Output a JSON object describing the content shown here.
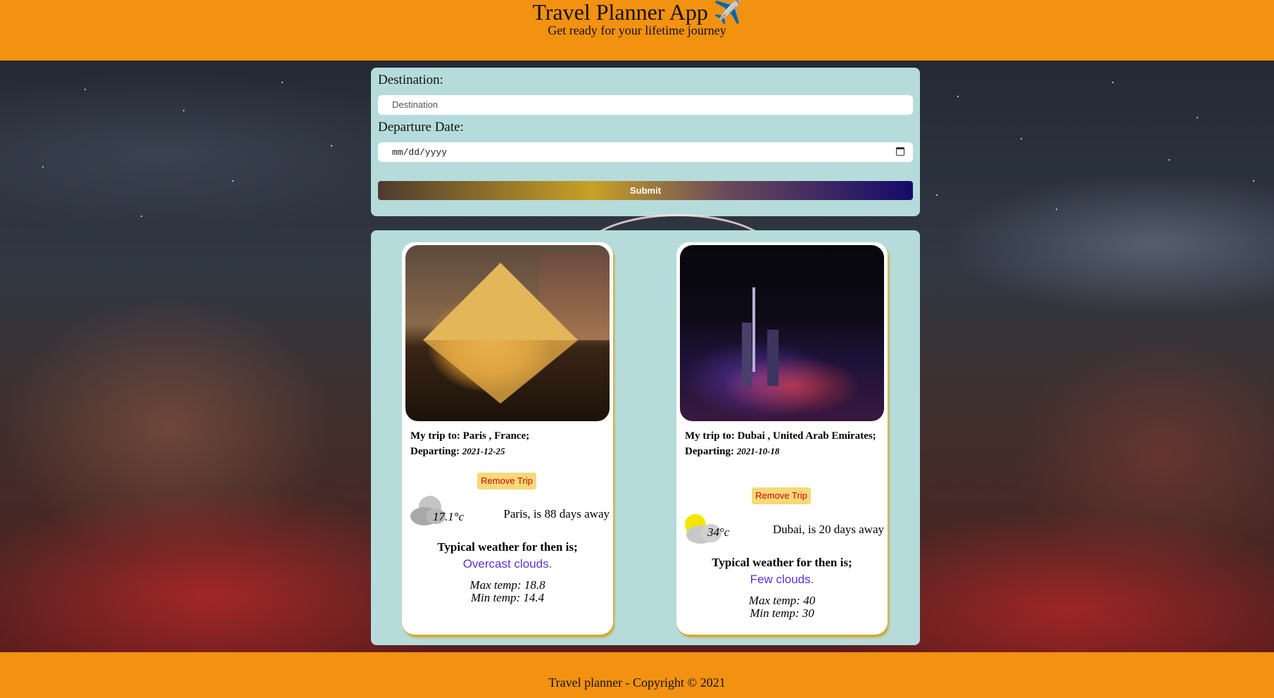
{
  "header": {
    "title": "Travel Planner App ✈️",
    "subtitle": "Get ready for your lifetime journey"
  },
  "form": {
    "destination_label": "Destination:",
    "destination_placeholder": "Destination",
    "date_label": "Departure Date:",
    "date_placeholder": "mm/dd/yyyy",
    "submit_label": "Submit"
  },
  "trips": [
    {
      "trip_prefix": "My trip to:",
      "destination": "Paris , France;",
      "departing_label": "Departing:",
      "departing_date": "2021-12-25",
      "remove_label": "Remove Trip",
      "weather_icon": "cloud-icon",
      "temp": "17.1°c",
      "days_away": "Paris, is 88 days away",
      "typical_label": "Typical weather for then is;",
      "description": "Overcast clouds.",
      "max_temp": "Max temp: 18.8",
      "min_temp": "Min temp:  14.4"
    },
    {
      "trip_prefix": "My trip to:",
      "destination": "Dubai , United Arab Emirates;",
      "departing_label": "Departing:",
      "departing_date": "2021-10-18",
      "remove_label": "Remove Trip",
      "weather_icon": "sun-cloud-icon",
      "temp": "34°c",
      "days_away": "Dubai, is 20 days away",
      "typical_label": "Typical weather for then is;",
      "description": "Few clouds.",
      "max_temp": "Max temp: 40",
      "min_temp": "Min temp:  30"
    }
  ],
  "footer": {
    "text": "Travel planner - Copyright © 2021"
  },
  "colors": {
    "header_bg": "#f39110",
    "panel_bg": "#b5dcdb",
    "description_text": "#5a31d6",
    "remove_text": "#d40000",
    "remove_bg": "#f6d978"
  }
}
